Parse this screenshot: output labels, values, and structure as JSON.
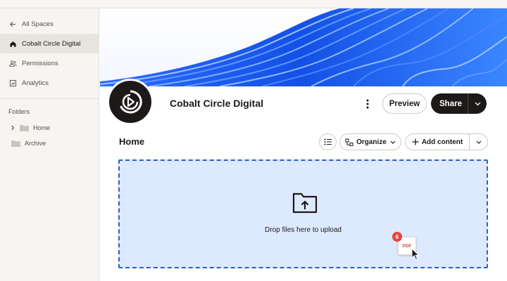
{
  "sidebar": {
    "nav": [
      {
        "label": "All Spaces",
        "icon": "arrow-left-icon"
      },
      {
        "label": "Cobalt Circle Digital",
        "icon": "home-icon",
        "active": true
      },
      {
        "label": "Permissions",
        "icon": "people-icon"
      },
      {
        "label": "Analytics",
        "icon": "chart-icon"
      }
    ],
    "folders_heading": "Folders",
    "folders": [
      {
        "label": "Home",
        "expandable": true
      },
      {
        "label": "Archive",
        "expandable": false
      }
    ]
  },
  "header": {
    "title": "Cobalt Circle Digital",
    "preview_label": "Preview",
    "share_label": "Share"
  },
  "section": {
    "title": "Home"
  },
  "toolbar": {
    "organize_label": "Organize",
    "add_content_label": "Add content"
  },
  "dropzone": {
    "text": "Drop files here to upload",
    "drag_count": "6",
    "drag_file_type": "PDF"
  },
  "colors": {
    "accent": "#1e5cff",
    "dropzone_bg": "#dde9fe",
    "dark": "#1e1919",
    "badge": "#e3453b"
  }
}
